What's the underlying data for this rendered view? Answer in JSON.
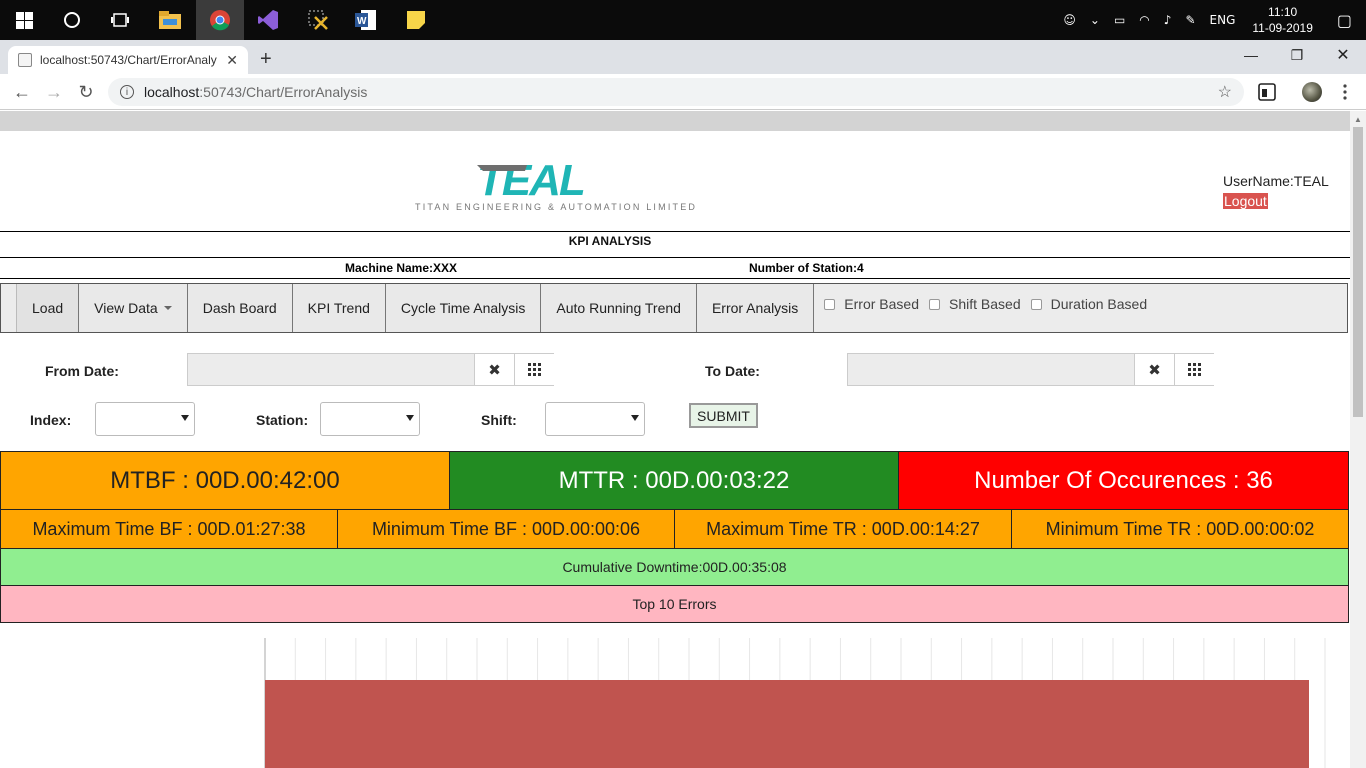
{
  "taskbar": {
    "lang": "ENG",
    "time": "11:10",
    "date": "11-09-2019"
  },
  "browser": {
    "tab_title": "localhost:50743/Chart/ErrorAnaly",
    "url_host": "localhost",
    "url_path": ":50743/Chart/ErrorAnalysis"
  },
  "header": {
    "username": "UserName:TEAL",
    "logout": "Logout",
    "logo_text": "TEAL",
    "logo_sub": "TITAN ENGINEERING & AUTOMATION LIMITED"
  },
  "kpi": {
    "title": "KPI ANALYSIS",
    "machine": "Machine Name:XXX",
    "stations": "Number of Station:4"
  },
  "nav": {
    "items": [
      "Load",
      "View Data",
      "Dash Board",
      "KPI Trend",
      "Cycle Time Analysis",
      "Auto Running Trend",
      "Error Analysis"
    ],
    "checks": [
      "Error Based",
      "Shift Based",
      "Duration Based"
    ]
  },
  "filters": {
    "from_label": "From Date:",
    "to_label": "To Date:",
    "index_label": "Index:",
    "station_label": "Station:",
    "shift_label": "Shift:",
    "submit": "SUBMIT"
  },
  "stats": {
    "mtbf": "MTBF : 00D.00:42:00",
    "mttr": "MTTR : 00D.00:03:22",
    "occurences": "Number Of Occurences : 36",
    "max_bf": "Maximum Time BF : 00D.01:27:38",
    "min_bf": "Minimum Time BF : 00D.00:00:06",
    "max_tr": "Maximum Time TR : 00D.00:14:27",
    "min_tr": "Minimum Time TR : 00D.00:00:02",
    "cumulative": "Cumulative Downtime:00D.00:35:08",
    "top10": "Top 10 Errors"
  },
  "colors": {
    "orange": "#ffa500",
    "green": "#228b22",
    "red": "#ff0000",
    "lightgreen": "#90ee90",
    "pink": "#ffb6c1",
    "bar": "#c0544f"
  },
  "chart_data": {
    "type": "bar",
    "series": [
      {
        "values": [
          1
        ]
      }
    ]
  }
}
